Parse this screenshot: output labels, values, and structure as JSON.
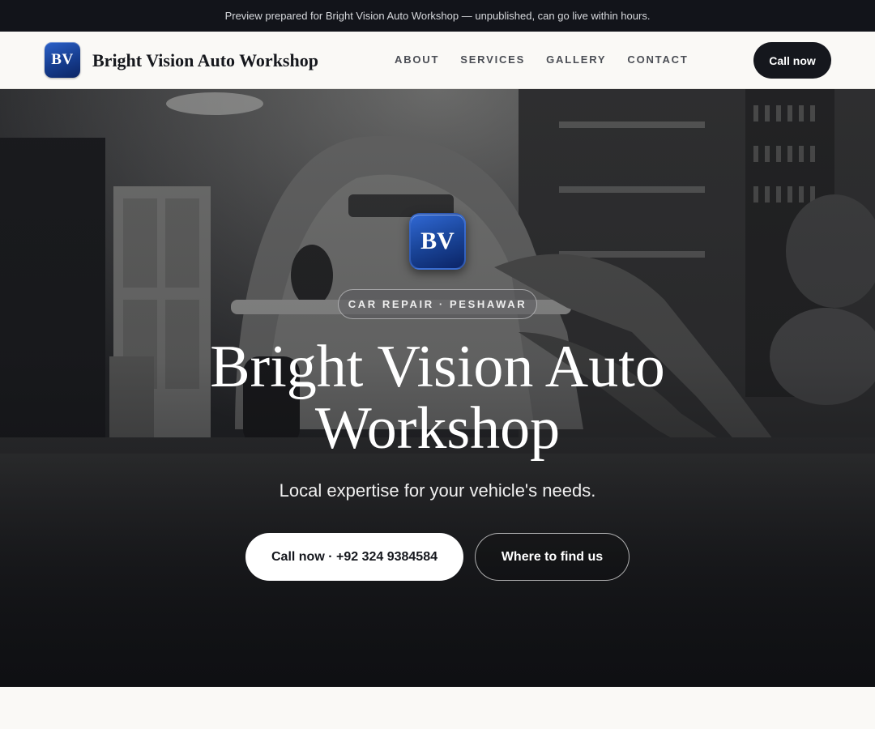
{
  "topbar": {
    "message": "Preview prepared for Bright Vision Auto Workshop — unpublished, can go live within hours."
  },
  "navbar": {
    "logo_text": "BV",
    "brand_name": "Bright Vision Auto Workshop",
    "links": [
      "ABOUT",
      "SERVICES",
      "GALLERY",
      "CONTACT"
    ],
    "cta_label": "Call now"
  },
  "hero": {
    "badge_text": "BV",
    "tagline": "CAR REPAIR · PESHAWAR",
    "title": "Bright Vision Auto Workshop",
    "subtitle": "Local expertise for your vehicle's needs.",
    "primary_button": "Call now · +92 324 9384584",
    "secondary_button": "Where to find us"
  },
  "colors": {
    "topbar_bg": "#12141a",
    "nav_bg": "#faf9f6",
    "brand_blue": "#1a4599",
    "cta_dark": "#15171d"
  }
}
